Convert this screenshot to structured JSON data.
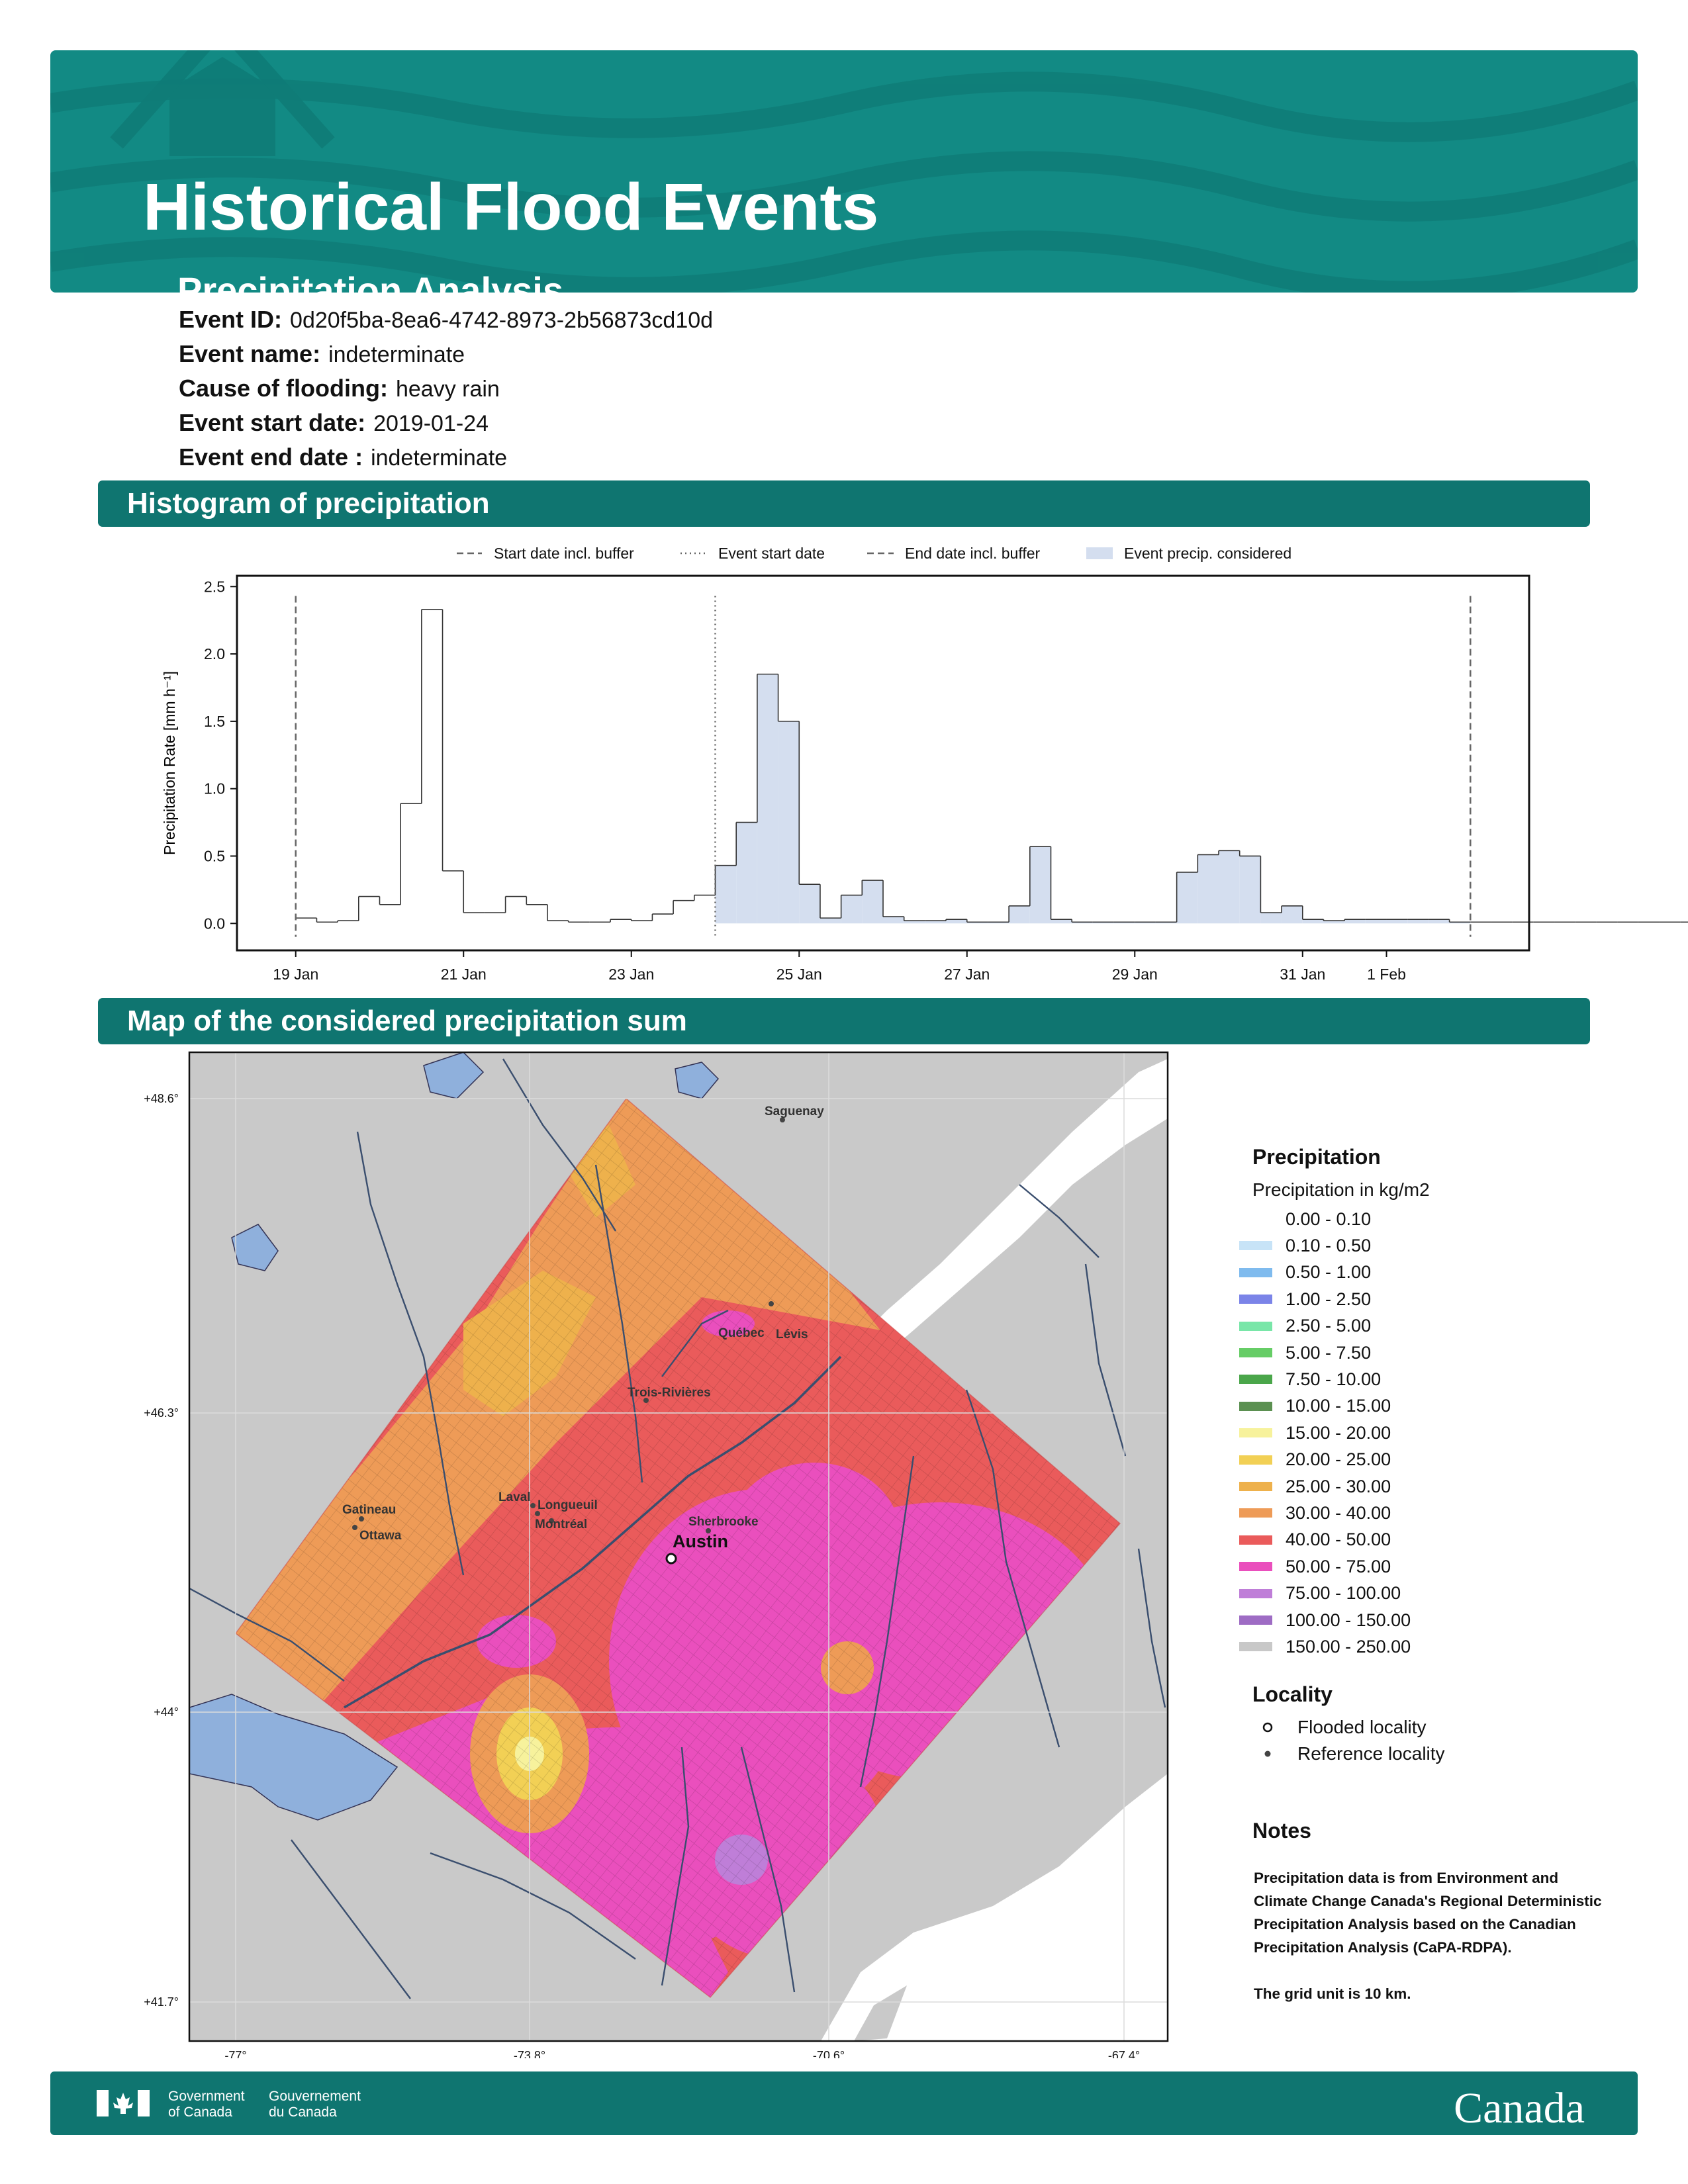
{
  "header": {
    "title": "Historical Flood Events",
    "subtitle": "Precipitation Analysis"
  },
  "event": {
    "id_label": "Event ID:",
    "id_value": "0d20f5ba-8ea6-4742-8973-2b56873cd10d",
    "name_label": "Event name:",
    "name_value": "indeterminate",
    "cause_label": "Cause of flooding:",
    "cause_value": "heavy rain",
    "start_label": "Event start date:",
    "start_value": "2019-01-24",
    "end_label": "Event end date :",
    "end_value": "indeterminate"
  },
  "histogram_section": {
    "title": "Histogram of precipitation"
  },
  "map_section": {
    "title": "Map of the considered precipitation sum"
  },
  "chart_data": {
    "type": "area",
    "xlabel": "",
    "ylabel": "Precipitation Rate [mm h⁻¹]",
    "ylim": [
      -0.2,
      2.58
    ],
    "xlim_days_from_19_jan": [
      -0.7,
      14.7
    ],
    "y_ticks": [
      "0.0",
      "0.5",
      "1.0",
      "1.5",
      "2.0",
      "2.5"
    ],
    "x_ticks": [
      {
        "label": "19 Jan",
        "day": 0
      },
      {
        "label": "21 Jan",
        "day": 2
      },
      {
        "label": "23 Jan",
        "day": 4
      },
      {
        "label": "25 Jan",
        "day": 6
      },
      {
        "label": "27 Jan",
        "day": 8
      },
      {
        "label": "29 Jan",
        "day": 10
      },
      {
        "label": "31 Jan",
        "day": 12
      },
      {
        "label": "1 Feb",
        "day": 13
      }
    ],
    "legend": [
      {
        "label": "Start date incl. buffer",
        "style": "dashed"
      },
      {
        "label": "Event start date",
        "style": "dotted"
      },
      {
        "label": "End date incl. buffer",
        "style": "dashed"
      },
      {
        "label": "Event precip. considered",
        "style": "patch",
        "color": "#d4deef"
      }
    ],
    "legend_position": "top-center",
    "markers": {
      "start_buffer": "19 Jan",
      "event_start": "24 Jan",
      "end_buffer": "2 Feb"
    },
    "bin_hours": 6,
    "series": [
      {
        "start": "19 Jan",
        "values": [
          0.04,
          0.01,
          0.02,
          0.2,
          0.14,
          0.89,
          2.33,
          0.39,
          0.08,
          0.08,
          0.2,
          0.14,
          0.02,
          0.01,
          0.01,
          0.03,
          0.02,
          0.07,
          0.17,
          0.21,
          0.43,
          0.75,
          1.85,
          1.5,
          0.29,
          0.04,
          0.21,
          0.32,
          0.05,
          0.02,
          0.02,
          0.03,
          0.01,
          0.01,
          0.13,
          0.57,
          0.03,
          0.01,
          0.01,
          0.01,
          0.01,
          0.01,
          0.38,
          0.51,
          0.54,
          0.5,
          0.08,
          0.13,
          0.03,
          0.02,
          0.03,
          0.03,
          0.03,
          0.03,
          0.03,
          0.01,
          0.01,
          0.01,
          0.01,
          0.01,
          0.01,
          0.01,
          0.01,
          0.01,
          0.01,
          0.01,
          0.01,
          0.01,
          0.01,
          0.01,
          0.01,
          0.01,
          0.01,
          0.01,
          0.01,
          0.01,
          0.01,
          0.01,
          0.01,
          0.01,
          0.01,
          0.01,
          0.01,
          0.01,
          0.01,
          0.01,
          0.01,
          0.01,
          0.01,
          0.01,
          0.01,
          0.01,
          0.01,
          0.01,
          0.01,
          0.01,
          0.01,
          0.01,
          0.01,
          0.01,
          0.01,
          0.01,
          0.01,
          0.01,
          0.01,
          0.01,
          0.01,
          0.01,
          0.01,
          0.01,
          0.01,
          0.01,
          0.01,
          0.01,
          0.01,
          0.01,
          0.01,
          0.01,
          0.01,
          0.01,
          0.01,
          0.01,
          0.01,
          0.01,
          0.01,
          0.01,
          0.01,
          0.01,
          0.01,
          0.01,
          0.01,
          0.01,
          0.01,
          0.01,
          0.01,
          0.01,
          0.01,
          0.01,
          0.01,
          0.01,
          0.01,
          0.01,
          0.01,
          0.01,
          0.01,
          0.01,
          0.01,
          0.01,
          0.01,
          0.01,
          0.01,
          0.01,
          0.01,
          0.01,
          0.01,
          0.01,
          0.01,
          0.01,
          0.01,
          0.01,
          0.01,
          0.01,
          0.01,
          0.01,
          0.01,
          0.01,
          0.01,
          0.01,
          0.01,
          0.01,
          0.01,
          0.01,
          0.01,
          0.01,
          0.01,
          0.01,
          0.01,
          0.01,
          0.01,
          0.01,
          0.01,
          0.01
        ]
      }
    ]
  },
  "map": {
    "lat_ticks": [
      "+48.6°",
      "+46.3°",
      "+44°",
      "+41.7°"
    ],
    "lon_ticks": [
      "-77°",
      "-73.8°",
      "-70.6°",
      "-67.4°"
    ],
    "flooded_locality": "Austin",
    "reference_localities": [
      "Saguenay",
      "Québec",
      "Lévis",
      "Trois-Rivières",
      "Gatineau",
      "Ottawa",
      "Laval",
      "Longueuil",
      "Montréal",
      "Sherbrooke"
    ]
  },
  "legend": {
    "title": "Precipitation",
    "subtitle": "Precipitation in kg/m2",
    "bins": [
      {
        "label": "0.00 - 0.10",
        "color": "#ffffff"
      },
      {
        "label": "0.10 - 0.50",
        "color": "#c7e3f7"
      },
      {
        "label": "0.50 - 1.00",
        "color": "#7fbbee"
      },
      {
        "label": "1.00 - 2.50",
        "color": "#7b84e8"
      },
      {
        "label": "2.50 - 5.00",
        "color": "#79e6a8"
      },
      {
        "label": "5.00 - 7.50",
        "color": "#66cd66"
      },
      {
        "label": "7.50 - 10.00",
        "color": "#4aa64a"
      },
      {
        "label": "10.00 - 15.00",
        "color": "#5b9051"
      },
      {
        "label": "15.00 - 20.00",
        "color": "#f7f29c"
      },
      {
        "label": "20.00 - 25.00",
        "color": "#f2d055"
      },
      {
        "label": "25.00 - 30.00",
        "color": "#eeb14c"
      },
      {
        "label": "30.00 - 40.00",
        "color": "#ee9b57"
      },
      {
        "label": "40.00 - 50.00",
        "color": "#ea5b5b"
      },
      {
        "label": "50.00 - 75.00",
        "color": "#ea4fbd"
      },
      {
        "label": "75.00 - 100.00",
        "color": "#bf7ed8"
      },
      {
        "label": "100.00 - 150.00",
        "color": "#9e6cc4"
      },
      {
        "label": "150.00 - 250.00",
        "color": "#c8c8c8"
      }
    ],
    "locality_title": "Locality",
    "flooded_label": "Flooded locality",
    "reference_label": "Reference locality"
  },
  "notes": {
    "title": "Notes",
    "text1": "Precipitation data is from Environment and Climate Change Canada's Regional Deterministic Precipitation Analysis based on the Canadian Precipitation Analysis (CaPA-RDPA).",
    "text2": "The grid unit is 10 km."
  },
  "footer": {
    "gov_en_line1": "Government",
    "gov_en_line2": "of Canada",
    "gov_fr_line1": "Gouvernement",
    "gov_fr_line2": "du Canada",
    "wordmark": "Canada"
  }
}
